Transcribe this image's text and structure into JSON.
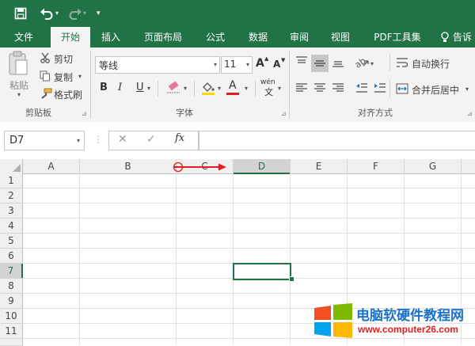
{
  "ribbon_tabs": [
    {
      "label": "文件"
    },
    {
      "label": "开始"
    },
    {
      "label": "插入"
    },
    {
      "label": "页面布局"
    },
    {
      "label": "公式"
    },
    {
      "label": "数据"
    },
    {
      "label": "审阅"
    },
    {
      "label": "视图"
    },
    {
      "label": "PDF工具集"
    },
    {
      "label": "告诉"
    }
  ],
  "clipboard": {
    "paste_label": "粘贴",
    "cut_label": "剪切",
    "copy_label": "复制",
    "format_painter_label": "格式刷",
    "group_label": "剪贴板"
  },
  "font": {
    "font_name": "等线",
    "font_size": "11",
    "bold": "B",
    "italic": "I",
    "underline": "U",
    "font_color": "A",
    "grow": "A",
    "shrink": "A",
    "wen": "wén",
    "wen_char": "文",
    "group_label": "字体"
  },
  "alignment": {
    "wrap_text_label": "自动换行",
    "merge_center_label": "合并后居中",
    "group_label": "对齐方式"
  },
  "formula_bar": {
    "name_box": "D7",
    "fx": "fx",
    "formula": ""
  },
  "columns": [
    "A",
    "B",
    "C",
    "D",
    "E",
    "F",
    "G"
  ],
  "rows": [
    "1",
    "2",
    "3",
    "4",
    "5",
    "6",
    "7",
    "8",
    "9",
    "10",
    "11"
  ],
  "active_cell": "D7",
  "watermark": {
    "title": "电脑软硬件教程网",
    "url": "www.computer26.com"
  },
  "colors": {
    "excel_green": "#217346",
    "ribbon_bg": "#f3f3f3",
    "annotation_red": "#e02020",
    "watermark_blue": "#1c72c8"
  }
}
